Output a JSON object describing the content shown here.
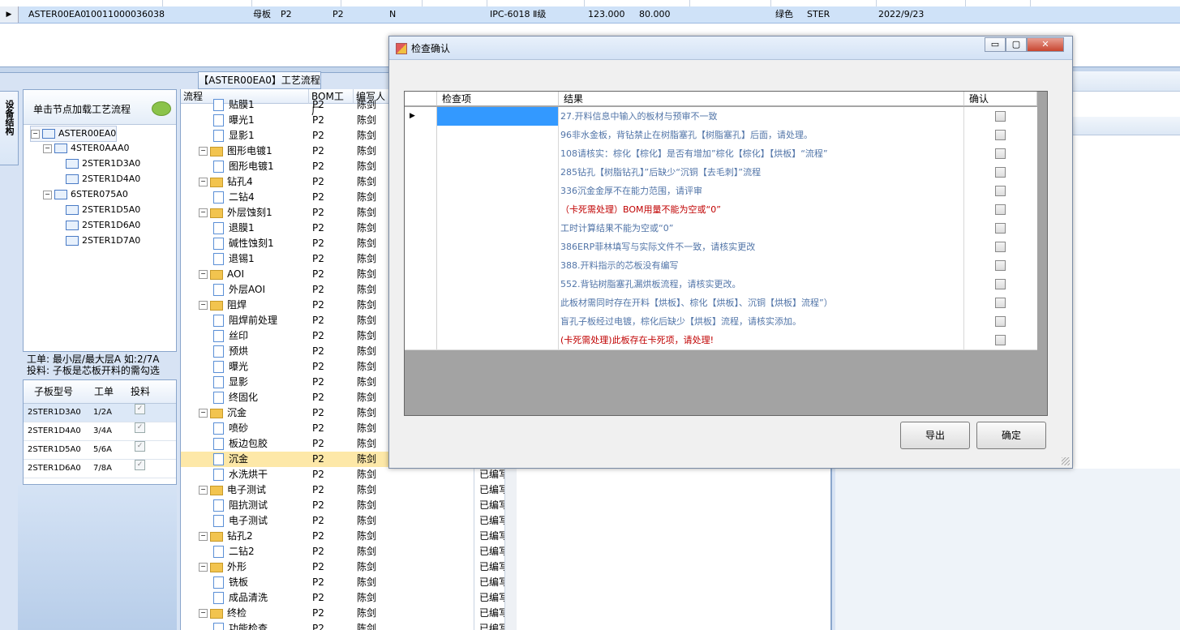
{
  "top_row": {
    "cells": [
      "ASTER00EA0",
      "10011000036038",
      "母板",
      "P2",
      "P2",
      "N",
      "IPC-6018 Ⅱ级",
      "123.000",
      "80.000",
      "绿色",
      "STER",
      "2022/9/23"
    ]
  },
  "left_tab": "设备结构",
  "left_panel": {
    "header": "单击节点加载工艺流程",
    "tree": [
      {
        "label": "ASTER00EA0",
        "level": 0
      },
      {
        "label": "4STER0AAA0",
        "level": 1
      },
      {
        "label": "2STER1D3A0",
        "level": 2
      },
      {
        "label": "2STER1D4A0",
        "level": 2
      },
      {
        "label": "6STER075A0",
        "level": 1
      },
      {
        "label": "2STER1D5A0",
        "level": 2
      },
      {
        "label": "2STER1D6A0",
        "level": 2
      },
      {
        "label": "2STER1D7A0",
        "level": 2
      }
    ]
  },
  "info": {
    "line1": "工单: 最小层/最大层A 如:2/7A",
    "line2": "投料: 子板是芯板开料的需勾选"
  },
  "sub_table": {
    "headers": [
      "子板型号",
      "工单",
      "投料"
    ],
    "rows": [
      {
        "model": "2STER1D3A0",
        "order": "1/2A",
        "feed": "✓"
      },
      {
        "model": "2STER1D4A0",
        "order": "3/4A",
        "feed": "✓"
      },
      {
        "model": "2STER1D5A0",
        "order": "5/6A",
        "feed": "✓"
      },
      {
        "model": "2STER1D6A0",
        "order": "7/8A",
        "feed": "✓"
      }
    ]
  },
  "process": {
    "tab_title": "【ASTER00EA0】工艺流程",
    "headers": [
      "流程",
      "BOM工厂",
      "编写人"
    ],
    "rows": [
      {
        "name": "贴膜1",
        "type": "doc",
        "bom": "P2",
        "who": "陈剑",
        "status": ""
      },
      {
        "name": "曝光1",
        "type": "doc",
        "bom": "P2",
        "who": "陈剑",
        "status": ""
      },
      {
        "name": "显影1",
        "type": "doc",
        "bom": "P2",
        "who": "陈剑",
        "status": ""
      },
      {
        "name": "图形电镀1",
        "type": "folder",
        "bom": "P2",
        "who": "陈剑",
        "status": ""
      },
      {
        "name": "图形电镀1",
        "type": "doc",
        "bom": "P2",
        "who": "陈剑",
        "status": ""
      },
      {
        "name": "钻孔4",
        "type": "folder",
        "bom": "P2",
        "who": "陈剑",
        "status": ""
      },
      {
        "name": "二钻4",
        "type": "doc",
        "bom": "P2",
        "who": "陈剑",
        "status": ""
      },
      {
        "name": "外层蚀刻1",
        "type": "folder",
        "bom": "P2",
        "who": "陈剑",
        "status": ""
      },
      {
        "name": "退膜1",
        "type": "doc",
        "bom": "P2",
        "who": "陈剑",
        "status": ""
      },
      {
        "name": "碱性蚀刻1",
        "type": "doc",
        "bom": "P2",
        "who": "陈剑",
        "status": ""
      },
      {
        "name": "退锡1",
        "type": "doc",
        "bom": "P2",
        "who": "陈剑",
        "status": ""
      },
      {
        "name": "AOI",
        "type": "folder",
        "bom": "P2",
        "who": "陈剑",
        "status": ""
      },
      {
        "name": "外层AOI",
        "type": "doc",
        "bom": "P2",
        "who": "陈剑",
        "status": ""
      },
      {
        "name": "阻焊",
        "type": "folder",
        "bom": "P2",
        "who": "陈剑",
        "status": ""
      },
      {
        "name": "阻焊前处理",
        "type": "doc",
        "bom": "P2",
        "who": "陈剑",
        "status": ""
      },
      {
        "name": "丝印",
        "type": "doc",
        "bom": "P2",
        "who": "陈剑",
        "status": ""
      },
      {
        "name": "预烘",
        "type": "doc",
        "bom": "P2",
        "who": "陈剑",
        "status": ""
      },
      {
        "name": "曝光",
        "type": "doc",
        "bom": "P2",
        "who": "陈剑",
        "status": ""
      },
      {
        "name": "显影",
        "type": "doc",
        "bom": "P2",
        "who": "陈剑",
        "status": ""
      },
      {
        "name": "终固化",
        "type": "doc",
        "bom": "P2",
        "who": "陈剑",
        "status": ""
      },
      {
        "name": "沉金",
        "type": "folder",
        "bom": "P2",
        "who": "陈剑",
        "status": ""
      },
      {
        "name": "喷砂",
        "type": "doc",
        "bom": "P2",
        "who": "陈剑",
        "status": ""
      },
      {
        "name": "板边包胶",
        "type": "doc",
        "bom": "P2",
        "who": "陈剑",
        "status": ""
      },
      {
        "name": "沉金",
        "type": "doc",
        "bom": "P2",
        "who": "陈剑",
        "status": ""
      },
      {
        "name": "水洗烘干",
        "type": "doc",
        "bom": "P2",
        "who": "陈剑",
        "status": "已编写"
      },
      {
        "name": "电子测试",
        "type": "folder",
        "bom": "P2",
        "who": "陈剑",
        "status": "已编写"
      },
      {
        "name": "阻抗测试",
        "type": "doc",
        "bom": "P2",
        "who": "陈剑",
        "status": "已编写"
      },
      {
        "name": "电子测试",
        "type": "doc",
        "bom": "P2",
        "who": "陈剑",
        "status": "已编写"
      },
      {
        "name": "钻孔2",
        "type": "folder",
        "bom": "P2",
        "who": "陈剑",
        "status": "已编写"
      },
      {
        "name": "二钻2",
        "type": "doc",
        "bom": "P2",
        "who": "陈剑",
        "status": "已编写"
      },
      {
        "name": "外形",
        "type": "folder",
        "bom": "P2",
        "who": "陈剑",
        "status": "已编写"
      },
      {
        "name": "铣板",
        "type": "doc",
        "bom": "P2",
        "who": "陈剑",
        "status": "已编写"
      },
      {
        "name": "成品清洗",
        "type": "doc",
        "bom": "P2",
        "who": "陈剑",
        "status": "已编写"
      },
      {
        "name": "终检",
        "type": "folder",
        "bom": "P2",
        "who": "陈剑",
        "status": "已编写"
      },
      {
        "name": "功能检查",
        "type": "doc",
        "bom": "P2",
        "who": "陈剑",
        "status": "已编写"
      }
    ]
  },
  "dialog": {
    "title": "检查确认",
    "columns": [
      "检查项",
      "结果",
      "确认"
    ],
    "rows": [
      {
        "result": "27.开料信息中输入的板材与预审不一致",
        "red": false
      },
      {
        "result": "96非水金板，背钻禁止在树脂塞孔【树脂塞孔】后面，请处理。",
        "red": false
      },
      {
        "result": "108请核实：棕化【棕化】是否有增加”棕化【棕化】【烘板】“流程”",
        "red": false
      },
      {
        "result": "285钻孔【树脂钻孔】”后缺少“沉铜【去毛刺】”流程",
        "red": false
      },
      {
        "result": "336沉金金厚不在能力范围，请评审",
        "red": false
      },
      {
        "result": "（卡死需处理）BOM用量不能为空或“0”",
        "red": true
      },
      {
        "result": "工时计算结果不能为空或“0”",
        "red": false
      },
      {
        "result": "386ERP菲林填写与实际文件不一致，请核实更改",
        "red": false
      },
      {
        "result": "388.开料指示的芯板没有编写",
        "red": false
      },
      {
        "result": "552.背钻树脂塞孔漏烘板流程，请核实更改。",
        "red": false
      },
      {
        "result": "此板材需同时存在开料【烘板】、棕化【烘板】、沉铜【烘板】流程”）",
        "red": false
      },
      {
        "result": "盲孔子板经过电镀，棕化后缺少【烘板】流程，请核实添加。",
        "red": false
      },
      {
        "result": "(卡死需处理)此板存在卡死项，请处理!",
        "red": true
      }
    ],
    "export_label": "导出",
    "ok_label": "确定",
    "min_glyph": "▭",
    "max_glyph": "▢",
    "close_glyph": "✕"
  },
  "colors": {
    "accent": "#3399ff",
    "result_text": "#5275a8",
    "error_text": "#c00000",
    "highlight_row": "#fde8a8"
  }
}
